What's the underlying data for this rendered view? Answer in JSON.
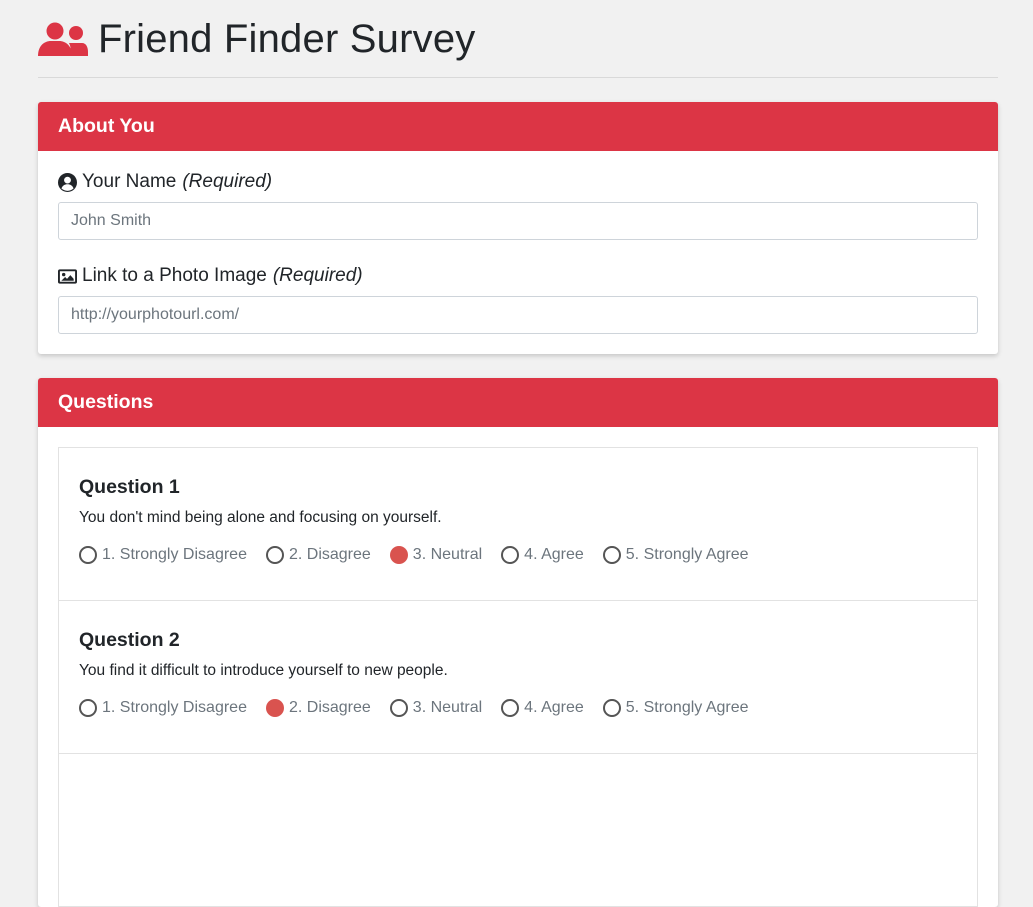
{
  "page": {
    "title": "Friend Finder Survey",
    "icon": "users-icon"
  },
  "colors": {
    "accent": "#dc3545",
    "radio_selected": "#d9534f",
    "background": "#f1f1f1"
  },
  "about": {
    "header": "About You",
    "name": {
      "icon": "user-circle-icon",
      "label": "Your Name",
      "required": "(Required)",
      "placeholder": "John Smith",
      "value": ""
    },
    "photo": {
      "icon": "image-icon",
      "label": "Link to a Photo Image",
      "required": "(Required)",
      "placeholder": "http://yourphotourl.com/",
      "value": ""
    }
  },
  "questions": {
    "header": "Questions",
    "items": [
      {
        "title": "Question 1",
        "text": "You don't mind being alone and focusing on yourself.",
        "options": [
          "1. Strongly Disagree",
          "2. Disagree",
          "3. Neutral",
          "4. Agree",
          "5. Strongly Agree"
        ],
        "selected": 2
      },
      {
        "title": "Question 2",
        "text": "You find it difficult to introduce yourself to new people.",
        "options": [
          "1. Strongly Disagree",
          "2. Disagree",
          "3. Neutral",
          "4. Agree",
          "5. Strongly Agree"
        ],
        "selected": 1
      }
    ]
  }
}
